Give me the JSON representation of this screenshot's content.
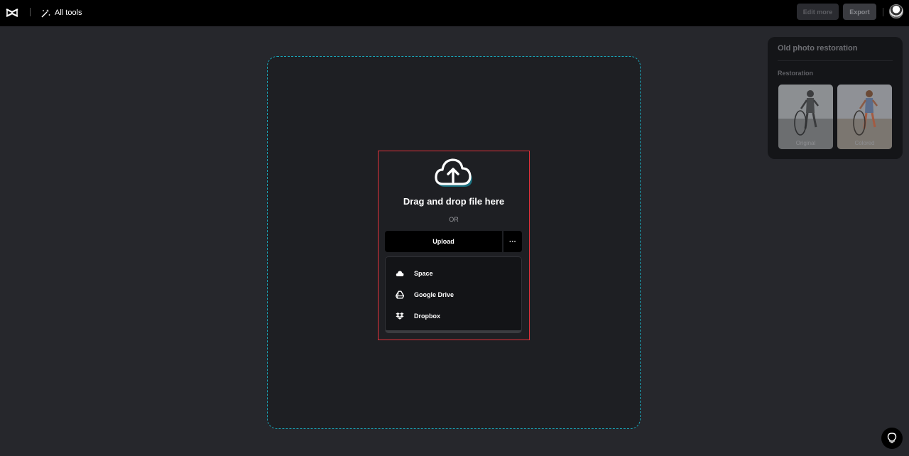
{
  "header": {
    "all_tools_label": "All tools",
    "edit_more_label": "Edit more",
    "export_label": "Export",
    "logo_icon": "capcut-logo-icon",
    "all_tools_icon": "magic-wand-icon",
    "avatar_icon": "user-avatar"
  },
  "uploader": {
    "icon": "cloud-upload-icon",
    "drag_text": "Drag and drop file here",
    "or_text": "OR",
    "upload_label": "Upload",
    "more_label": "···",
    "menu": [
      {
        "label": "Space",
        "icon": "cloud-icon"
      },
      {
        "label": "Google Drive",
        "icon": "google-drive-icon"
      },
      {
        "label": "Dropbox",
        "icon": "dropbox-icon"
      }
    ]
  },
  "panel": {
    "title": "Old photo restoration",
    "section": "Restoration",
    "thumbnails": [
      {
        "caption": "Original"
      },
      {
        "caption": "Colored"
      }
    ]
  },
  "colors": {
    "accent": "#1aa5b8",
    "highlight": "#e0313a",
    "background": "#26272c"
  },
  "help_icon": "lightbulb-icon"
}
